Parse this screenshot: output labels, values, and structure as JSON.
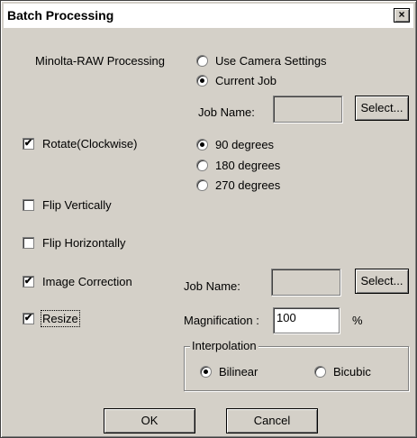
{
  "title": "Batch Processing",
  "close_label": "×",
  "minolta": {
    "label": "Minolta-RAW Processing",
    "option_camera": "Use Camera Settings",
    "option_job": "Current Job",
    "job_name_label": "Job Name:",
    "job_name_value": "",
    "select_label": "Select..."
  },
  "rotate": {
    "label": "Rotate(Clockwise)",
    "checked": true,
    "options": [
      "90 degrees",
      "180 degrees",
      "270 degrees"
    ],
    "selected": "90 degrees"
  },
  "flip_vertical": {
    "label": "Flip Vertically",
    "checked": false
  },
  "flip_horizontal": {
    "label": "Flip Horizontally",
    "checked": false
  },
  "image_correction": {
    "label": "Image Correction",
    "checked": true,
    "job_name_label": "Job Name:",
    "job_name_value": "",
    "select_label": "Select..."
  },
  "resize": {
    "label": "Resize",
    "checked": true,
    "magnification_label": "Magnification :",
    "magnification_value": "100",
    "unit": "%"
  },
  "interpolation": {
    "label": "Interpolation",
    "option_bilinear": "Bilinear",
    "option_bicubic": "Bicubic",
    "selected": "Bilinear"
  },
  "buttons": {
    "ok": "OK",
    "cancel": "Cancel"
  },
  "check_glyph": "✔"
}
